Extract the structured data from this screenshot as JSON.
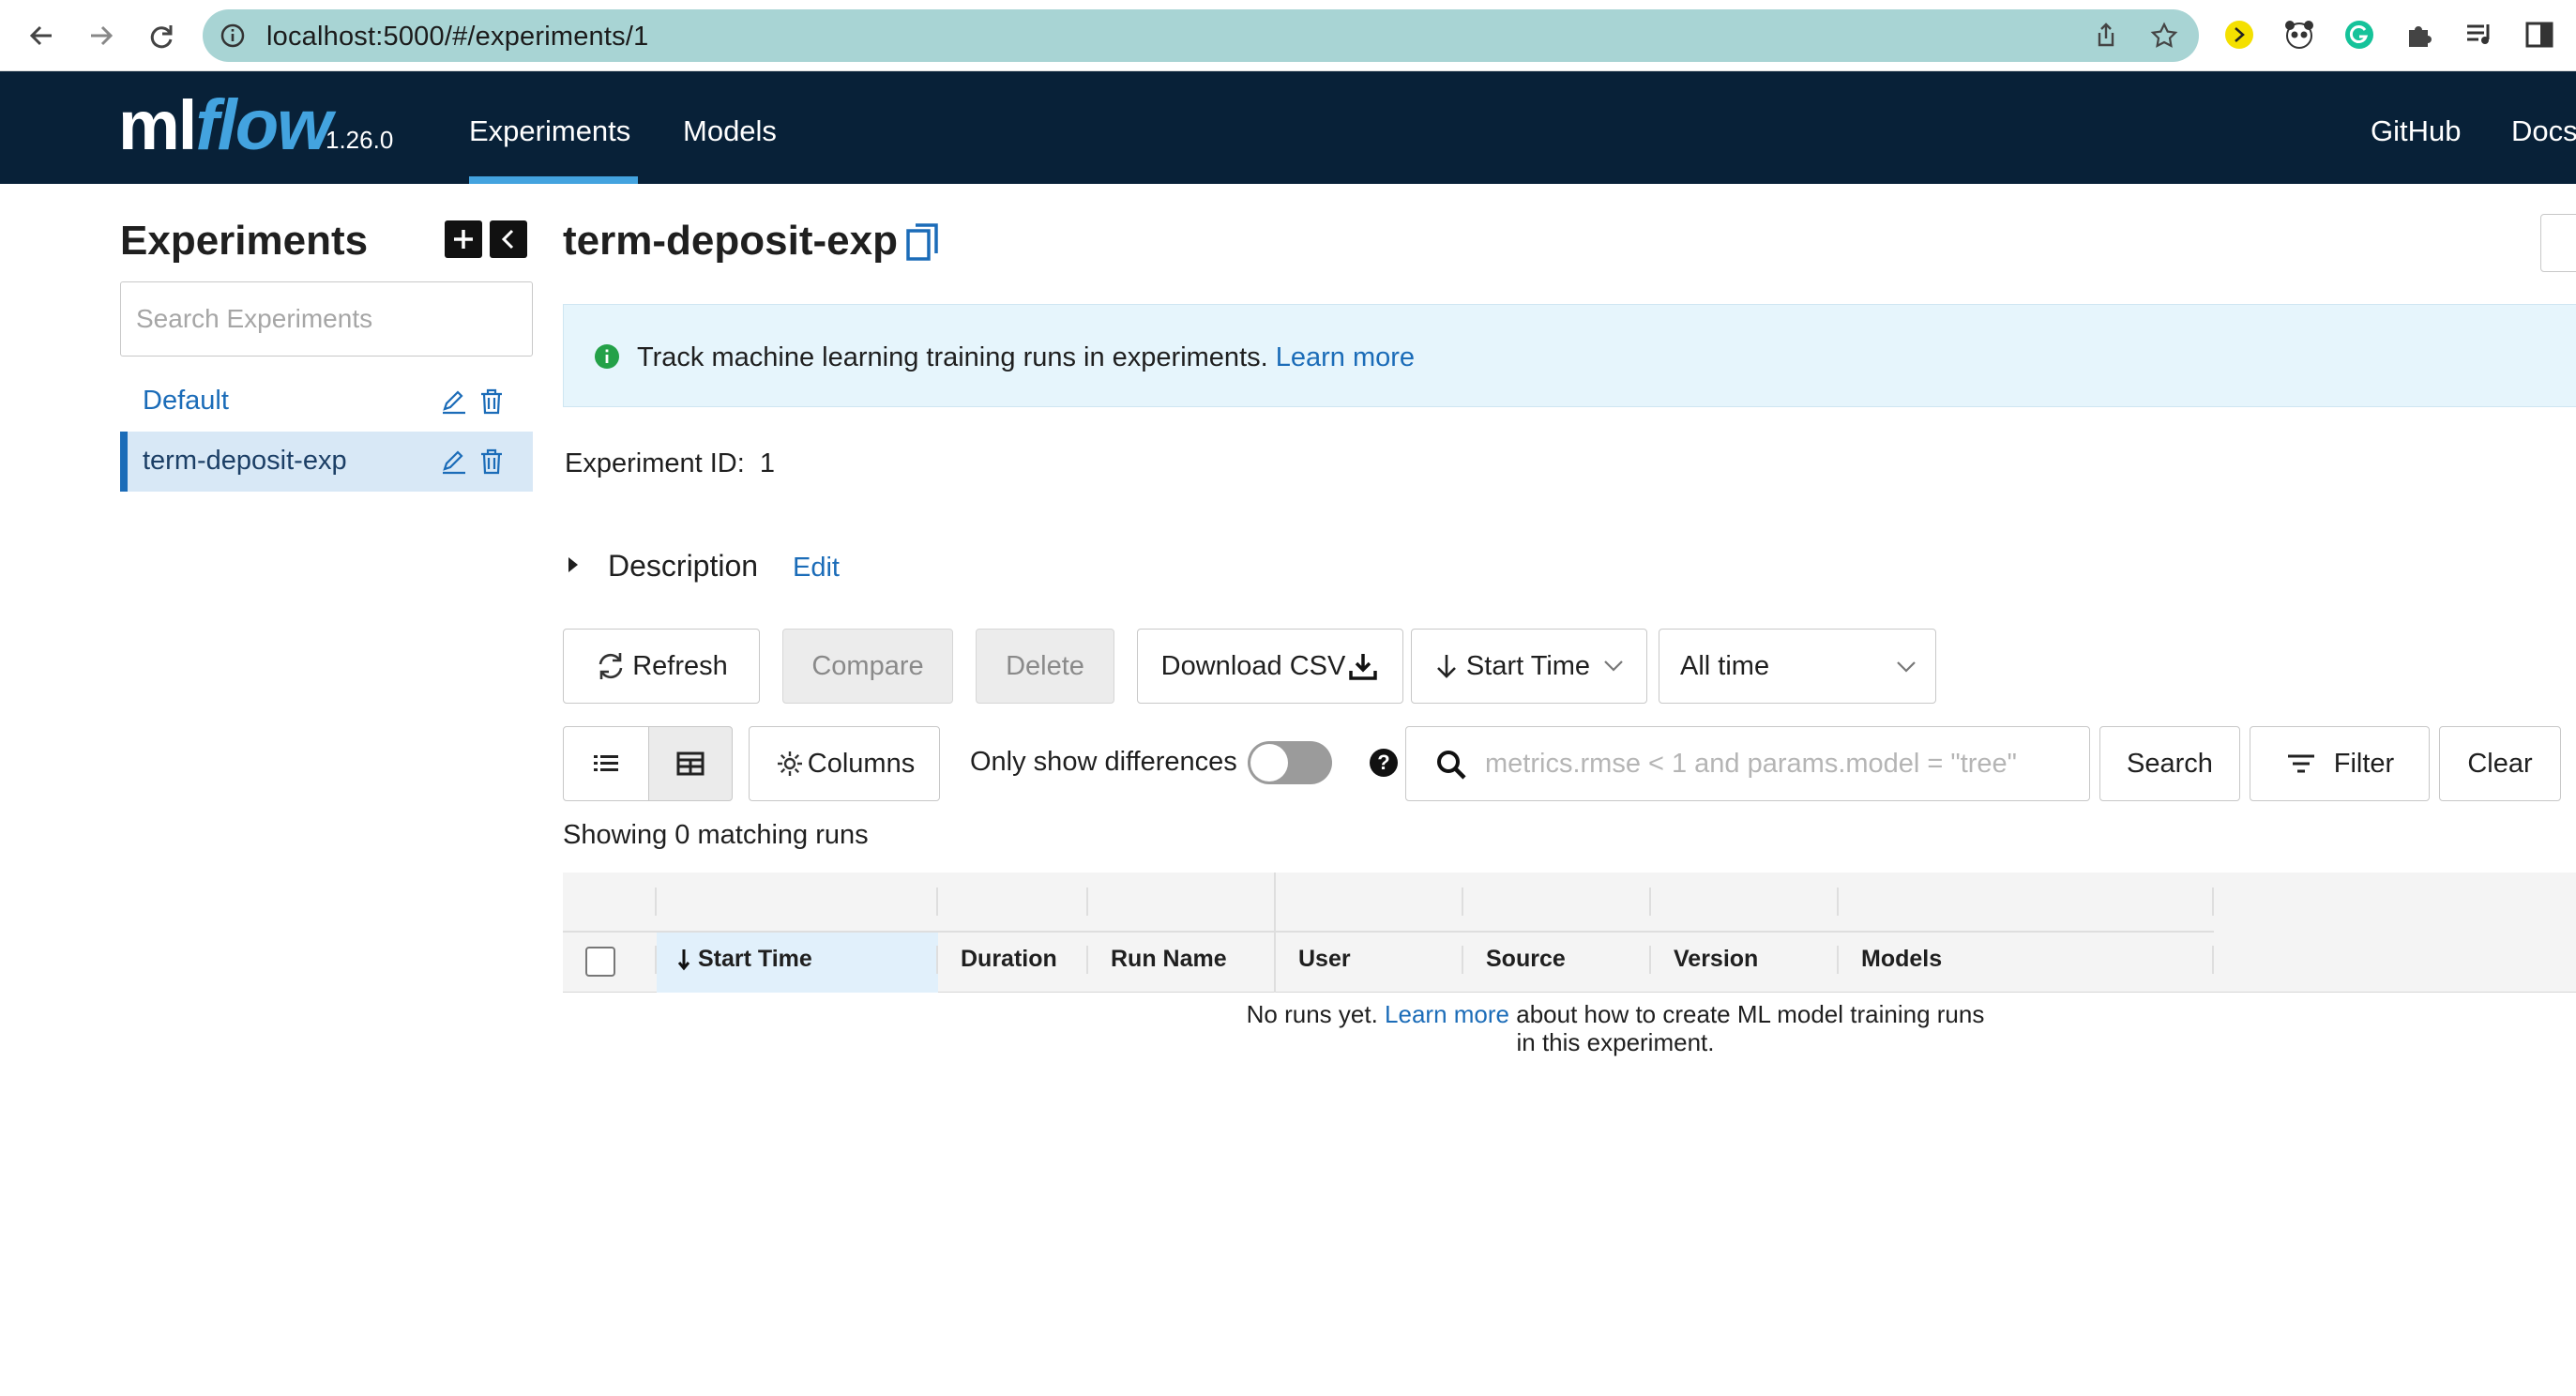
{
  "browser": {
    "url": "localhost:5000/#/experiments/1"
  },
  "header": {
    "logo_ml": "ml",
    "logo_flow": "flow",
    "version": "1.26.0",
    "nav": [
      {
        "label": "Experiments",
        "active": true
      },
      {
        "label": "Models",
        "active": false
      }
    ],
    "right_nav": [
      {
        "label": "GitHub"
      },
      {
        "label": "Docs"
      }
    ]
  },
  "sidebar": {
    "title": "Experiments",
    "add_icon": "plus-icon",
    "collapse_icon": "chevron-left-icon",
    "search_placeholder": "Search Experiments",
    "items": [
      {
        "label": "Default",
        "active": false
      },
      {
        "label": "term-deposit-exp",
        "active": true
      }
    ]
  },
  "main": {
    "title": "term-deposit-exp",
    "info_banner": {
      "text": "Track machine learning training runs in experiments.",
      "link": "Learn more"
    },
    "experiment_id_label": "Experiment ID:",
    "experiment_id": "1",
    "description_label": "Description",
    "description_edit": "Edit",
    "toolbar": {
      "refresh": "Refresh",
      "compare": "Compare",
      "delete": "Delete",
      "download_csv": "Download CSV",
      "sort": "Start Time",
      "time_range": "All time",
      "columns": "Columns",
      "only_diff": "Only show differences",
      "only_diff_on": false,
      "search_placeholder": "metrics.rmse < 1 and params.model = \"tree\"",
      "search": "Search",
      "filter": "Filter",
      "clear": "Clear"
    },
    "showing": "Showing 0 matching runs",
    "grid": {
      "columns": [
        "Start Time",
        "Duration",
        "Run Name",
        "User",
        "Source",
        "Version",
        "Models"
      ],
      "sorted_column": "Start Time",
      "empty_pre": "No runs yet.",
      "empty_link": "Learn more",
      "empty_post": "about how to create ML model training runs in this experiment."
    }
  },
  "colors": {
    "header_bg": "#082138",
    "accent": "#43a3df",
    "link": "#1b6cb8",
    "url_bar": "#a8d4d4",
    "info_bg": "#e6f5fc"
  }
}
